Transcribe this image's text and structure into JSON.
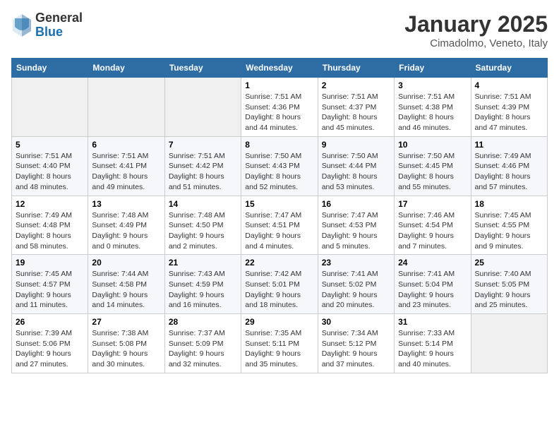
{
  "header": {
    "logo_general": "General",
    "logo_blue": "Blue",
    "month_title": "January 2025",
    "location": "Cimadolmo, Veneto, Italy"
  },
  "weekdays": [
    "Sunday",
    "Monday",
    "Tuesday",
    "Wednesday",
    "Thursday",
    "Friday",
    "Saturday"
  ],
  "weeks": [
    [
      {
        "day": "",
        "info": ""
      },
      {
        "day": "",
        "info": ""
      },
      {
        "day": "",
        "info": ""
      },
      {
        "day": "1",
        "info": "Sunrise: 7:51 AM\nSunset: 4:36 PM\nDaylight: 8 hours\nand 44 minutes."
      },
      {
        "day": "2",
        "info": "Sunrise: 7:51 AM\nSunset: 4:37 PM\nDaylight: 8 hours\nand 45 minutes."
      },
      {
        "day": "3",
        "info": "Sunrise: 7:51 AM\nSunset: 4:38 PM\nDaylight: 8 hours\nand 46 minutes."
      },
      {
        "day": "4",
        "info": "Sunrise: 7:51 AM\nSunset: 4:39 PM\nDaylight: 8 hours\nand 47 minutes."
      }
    ],
    [
      {
        "day": "5",
        "info": "Sunrise: 7:51 AM\nSunset: 4:40 PM\nDaylight: 8 hours\nand 48 minutes."
      },
      {
        "day": "6",
        "info": "Sunrise: 7:51 AM\nSunset: 4:41 PM\nDaylight: 8 hours\nand 49 minutes."
      },
      {
        "day": "7",
        "info": "Sunrise: 7:51 AM\nSunset: 4:42 PM\nDaylight: 8 hours\nand 51 minutes."
      },
      {
        "day": "8",
        "info": "Sunrise: 7:50 AM\nSunset: 4:43 PM\nDaylight: 8 hours\nand 52 minutes."
      },
      {
        "day": "9",
        "info": "Sunrise: 7:50 AM\nSunset: 4:44 PM\nDaylight: 8 hours\nand 53 minutes."
      },
      {
        "day": "10",
        "info": "Sunrise: 7:50 AM\nSunset: 4:45 PM\nDaylight: 8 hours\nand 55 minutes."
      },
      {
        "day": "11",
        "info": "Sunrise: 7:49 AM\nSunset: 4:46 PM\nDaylight: 8 hours\nand 57 minutes."
      }
    ],
    [
      {
        "day": "12",
        "info": "Sunrise: 7:49 AM\nSunset: 4:48 PM\nDaylight: 8 hours\nand 58 minutes."
      },
      {
        "day": "13",
        "info": "Sunrise: 7:48 AM\nSunset: 4:49 PM\nDaylight: 9 hours\nand 0 minutes."
      },
      {
        "day": "14",
        "info": "Sunrise: 7:48 AM\nSunset: 4:50 PM\nDaylight: 9 hours\nand 2 minutes."
      },
      {
        "day": "15",
        "info": "Sunrise: 7:47 AM\nSunset: 4:51 PM\nDaylight: 9 hours\nand 4 minutes."
      },
      {
        "day": "16",
        "info": "Sunrise: 7:47 AM\nSunset: 4:53 PM\nDaylight: 9 hours\nand 5 minutes."
      },
      {
        "day": "17",
        "info": "Sunrise: 7:46 AM\nSunset: 4:54 PM\nDaylight: 9 hours\nand 7 minutes."
      },
      {
        "day": "18",
        "info": "Sunrise: 7:45 AM\nSunset: 4:55 PM\nDaylight: 9 hours\nand 9 minutes."
      }
    ],
    [
      {
        "day": "19",
        "info": "Sunrise: 7:45 AM\nSunset: 4:57 PM\nDaylight: 9 hours\nand 11 minutes."
      },
      {
        "day": "20",
        "info": "Sunrise: 7:44 AM\nSunset: 4:58 PM\nDaylight: 9 hours\nand 14 minutes."
      },
      {
        "day": "21",
        "info": "Sunrise: 7:43 AM\nSunset: 4:59 PM\nDaylight: 9 hours\nand 16 minutes."
      },
      {
        "day": "22",
        "info": "Sunrise: 7:42 AM\nSunset: 5:01 PM\nDaylight: 9 hours\nand 18 minutes."
      },
      {
        "day": "23",
        "info": "Sunrise: 7:41 AM\nSunset: 5:02 PM\nDaylight: 9 hours\nand 20 minutes."
      },
      {
        "day": "24",
        "info": "Sunrise: 7:41 AM\nSunset: 5:04 PM\nDaylight: 9 hours\nand 23 minutes."
      },
      {
        "day": "25",
        "info": "Sunrise: 7:40 AM\nSunset: 5:05 PM\nDaylight: 9 hours\nand 25 minutes."
      }
    ],
    [
      {
        "day": "26",
        "info": "Sunrise: 7:39 AM\nSunset: 5:06 PM\nDaylight: 9 hours\nand 27 minutes."
      },
      {
        "day": "27",
        "info": "Sunrise: 7:38 AM\nSunset: 5:08 PM\nDaylight: 9 hours\nand 30 minutes."
      },
      {
        "day": "28",
        "info": "Sunrise: 7:37 AM\nSunset: 5:09 PM\nDaylight: 9 hours\nand 32 minutes."
      },
      {
        "day": "29",
        "info": "Sunrise: 7:35 AM\nSunset: 5:11 PM\nDaylight: 9 hours\nand 35 minutes."
      },
      {
        "day": "30",
        "info": "Sunrise: 7:34 AM\nSunset: 5:12 PM\nDaylight: 9 hours\nand 37 minutes."
      },
      {
        "day": "31",
        "info": "Sunrise: 7:33 AM\nSunset: 5:14 PM\nDaylight: 9 hours\nand 40 minutes."
      },
      {
        "day": "",
        "info": ""
      }
    ]
  ]
}
